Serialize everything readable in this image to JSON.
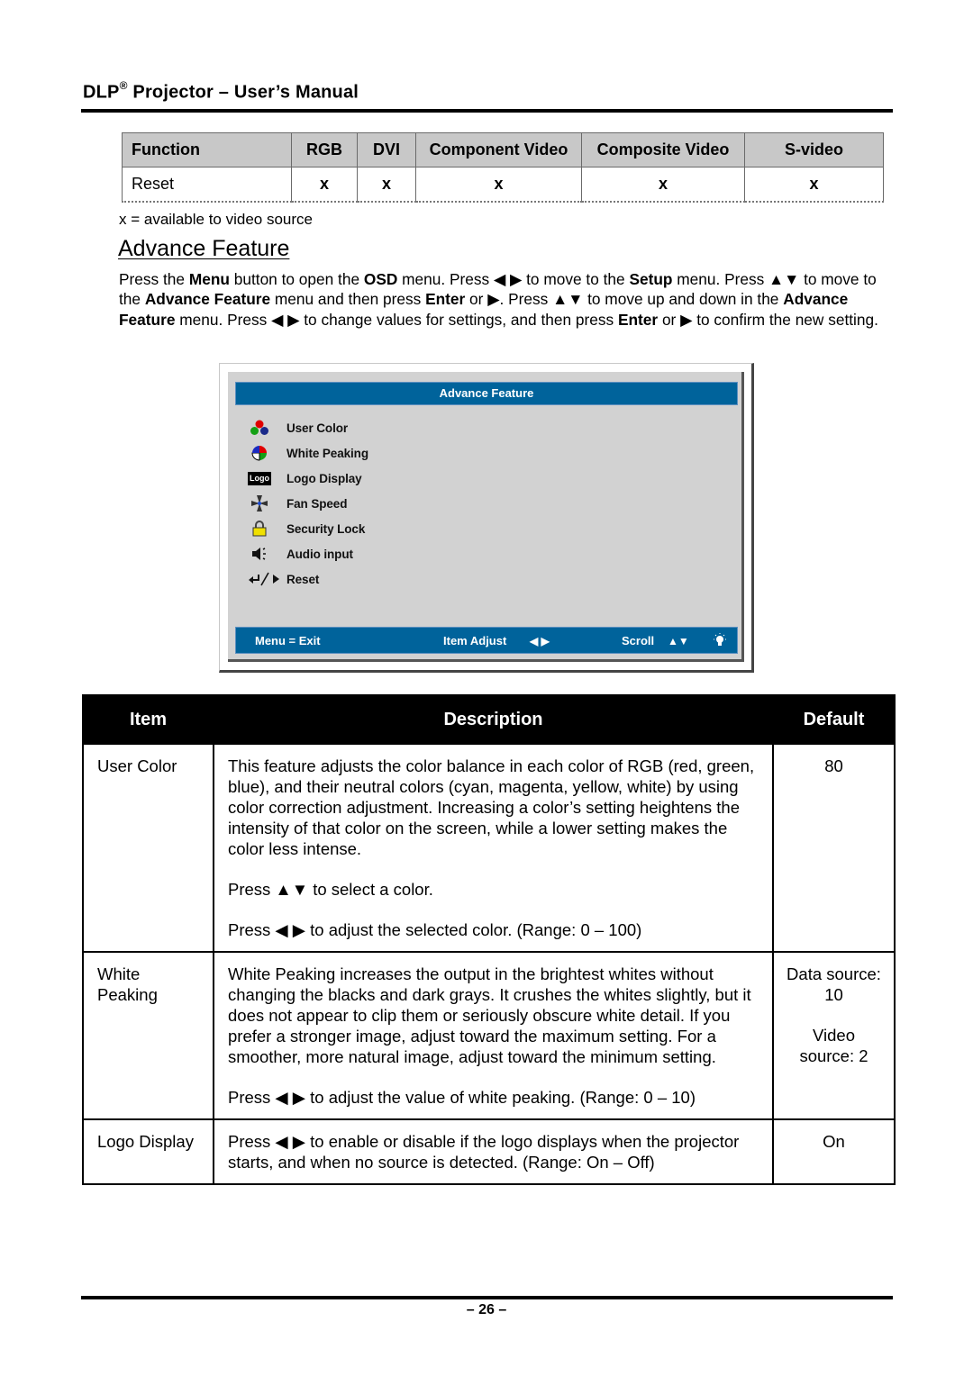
{
  "header": {
    "brand": "DLP",
    "registered": "®",
    "title_rest": " Projector – User’s Manual"
  },
  "source_table": {
    "headers": [
      "Function",
      "RGB",
      "DVI",
      "Component Video",
      "Composite Video",
      "S-video"
    ],
    "rows": [
      {
        "function": "Reset",
        "rgb": "x",
        "dvi": "x",
        "component": "x",
        "composite": "x",
        "svideo": "x"
      }
    ],
    "note": "x = available to video source"
  },
  "section": {
    "title": "Advance Feature",
    "intro": [
      {
        "t": "Press the "
      },
      {
        "b": "Menu"
      },
      {
        "t": " button to open the "
      },
      {
        "b": "OSD"
      },
      {
        "t": " menu. Press ◀ ▶ to move to the "
      },
      {
        "b": "Setup"
      },
      {
        "t": " menu. Press ▲▼ to move to the "
      },
      {
        "b": "Advance Feature"
      },
      {
        "t": " menu and then press "
      },
      {
        "b": "Enter"
      },
      {
        "t": " or ▶. Press ▲▼ to move up and down in the "
      },
      {
        "b": "Advance Feature"
      },
      {
        "t": " menu. Press ◀ ▶ to change values for settings, and then press "
      },
      {
        "b": "Enter"
      },
      {
        "t": " or ▶ to confirm the new setting."
      }
    ]
  },
  "osd": {
    "title": "Advance Feature",
    "items": [
      {
        "label": "User Color",
        "icon": "user-color-icon"
      },
      {
        "label": "White Peaking",
        "icon": "white-peaking-icon"
      },
      {
        "label": "Logo Display",
        "icon": "logo-display-icon",
        "icon_text": "Logo"
      },
      {
        "label": "Fan Speed",
        "icon": "fan-speed-icon"
      },
      {
        "label": "Security Lock",
        "icon": "security-lock-icon"
      },
      {
        "label": "Audio input",
        "icon": "audio-input-icon"
      },
      {
        "label": "Reset",
        "icon": "reset-icon"
      }
    ],
    "footer": {
      "exit": "Menu = Exit",
      "adjust": "Item Adjust",
      "adjust_glyph": "◀ ▶",
      "scroll": "Scroll",
      "scroll_glyph": "▲▼"
    },
    "colors": {
      "bar": "#00639b",
      "panel": "#d2d2d2"
    }
  },
  "desc_table": {
    "headers": {
      "item": "Item",
      "description": "Description",
      "default": "Default"
    },
    "rows": [
      {
        "item": "User Color",
        "paragraphs": [
          "This feature adjusts the color balance in each color of RGB (red, green, blue), and their neutral colors (cyan, magenta, yellow, white) by using color correction adjustment. Increasing a color’s setting heightens the intensity of that color on the screen, while a lower setting makes the color less intense.",
          "Press ▲▼ to select a color.",
          "Press ◀ ▶ to adjust the selected color. (Range: 0 – 100)"
        ],
        "defaults": [
          "80"
        ]
      },
      {
        "item": "White Peaking",
        "paragraphs": [
          "White Peaking increases the output in the brightest whites without changing the blacks and dark grays. It crushes the whites slightly, but it does not appear to clip them or seriously obscure white detail. If you prefer a stronger image, adjust toward the maximum setting. For a smoother, more natural image, adjust toward the minimum setting.",
          "Press ◀ ▶ to adjust the value of white peaking. (Range: 0 – 10)"
        ],
        "defaults": [
          "Data source: 10",
          "Video source: 2"
        ]
      },
      {
        "item": "Logo Display",
        "paragraphs": [
          "Press ◀ ▶ to enable or disable if the logo displays when the projector starts, and when no source is detected. (Range: On – Off)"
        ],
        "defaults": [
          "On"
        ]
      }
    ]
  },
  "footer": {
    "page": "– 26 –"
  }
}
